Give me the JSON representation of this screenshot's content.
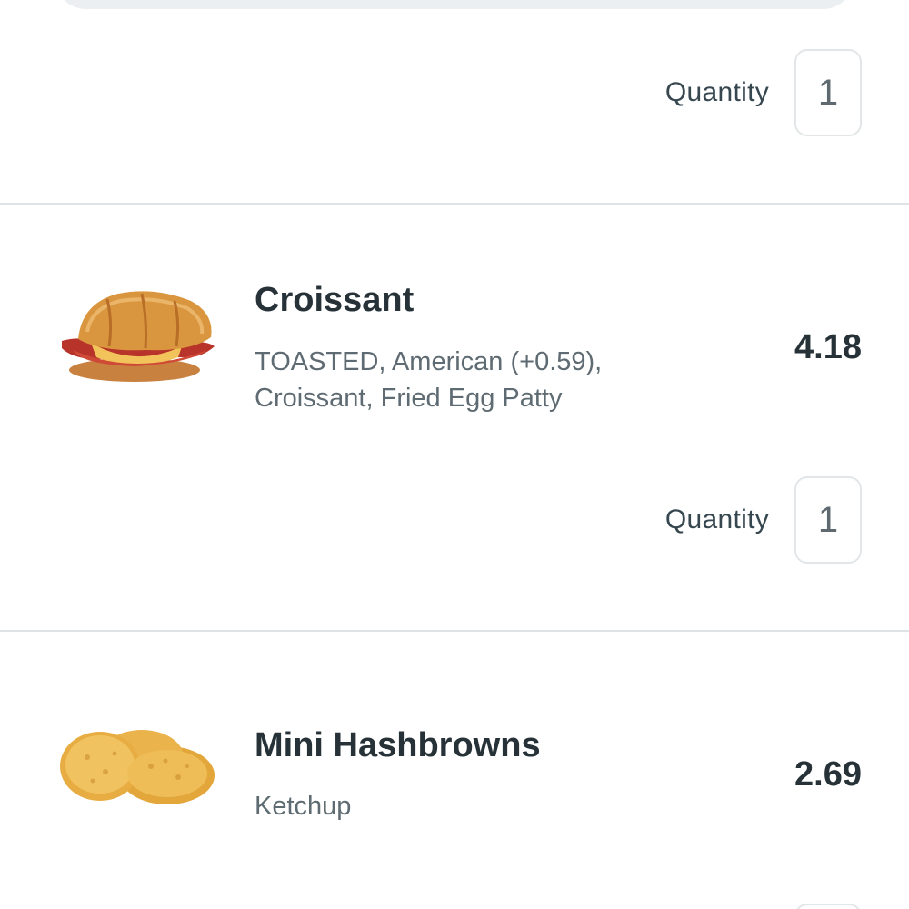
{
  "order": {
    "first_item": {
      "quantity_label": "Quantity",
      "quantity": "1"
    },
    "items": [
      {
        "name": "Croissant",
        "description": "TOASTED, American (+0.59), Croissant, Fried Egg Patty",
        "price": "4.18",
        "quantity_label": "Quantity",
        "quantity": "1",
        "image_icon": "croissant-sandwich-icon"
      },
      {
        "name": "Mini Hashbrowns",
        "description": "Ketchup",
        "price": "2.69",
        "image_icon": "hashbrowns-icon"
      }
    ]
  }
}
